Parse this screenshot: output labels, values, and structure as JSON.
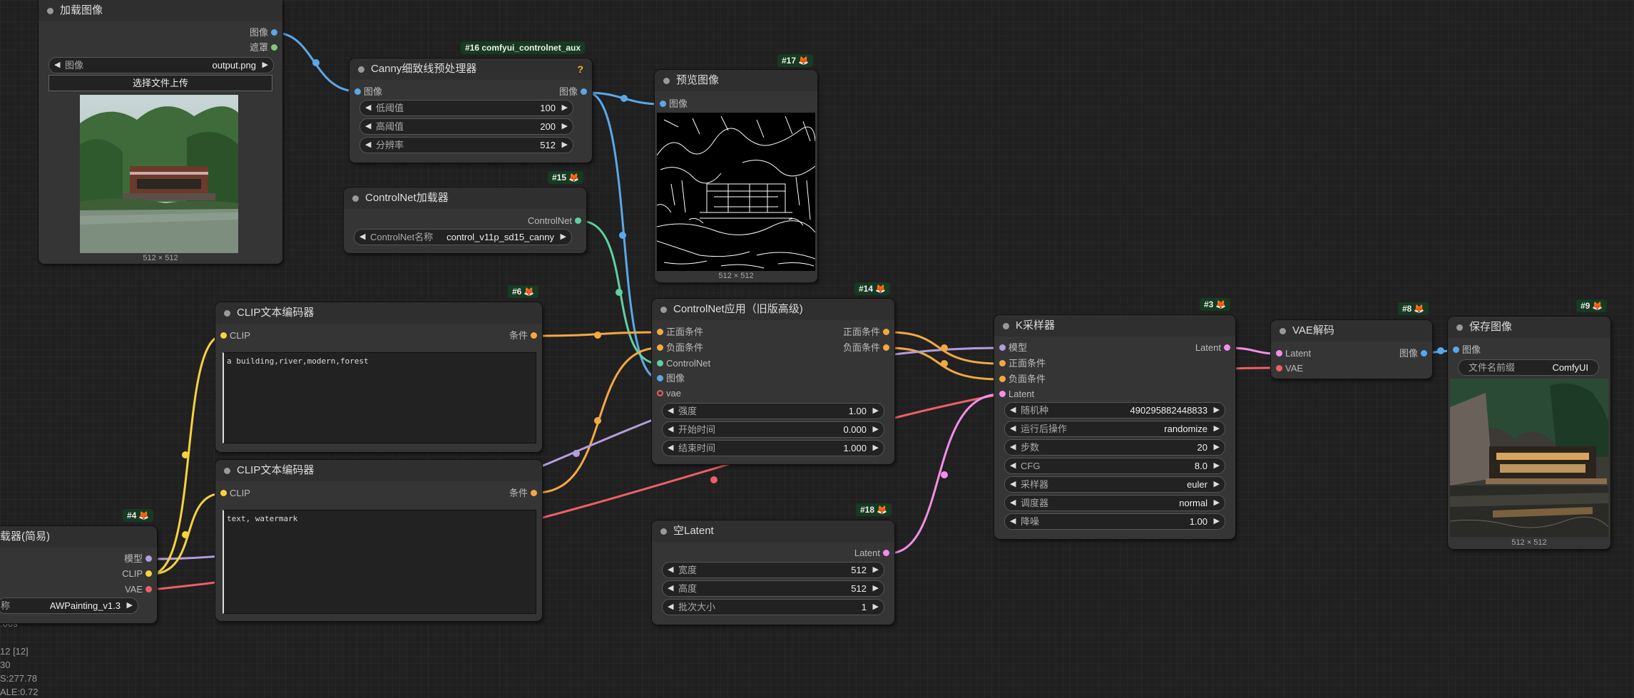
{
  "colors": {
    "image": "#5aa8e8",
    "mask": "#81c77b",
    "controlnet": "#5fd1a2",
    "conditioning": "#f5a842",
    "model": "#b39ddb",
    "clip": "#f6d33c",
    "vae": "#ee5f64",
    "latent": "#f48ee8"
  },
  "nodes": {
    "load_image": {
      "title": "加载图像",
      "out_image": "图像",
      "out_mask": "遮罩",
      "image_label": "图像",
      "image_value": "output.png",
      "upload": "选择文件上传",
      "dims": "512 × 512"
    },
    "canny": {
      "badge": "#16 comfyui_controlnet_aux",
      "title": "Canny细致线预处理器",
      "help": "?",
      "in_image": "图像",
      "out_image": "图像",
      "w1_label": "低阈值",
      "w1_value": "100",
      "w2_label": "高阈值",
      "w2_value": "200",
      "w3_label": "分辨率",
      "w3_value": "512"
    },
    "preview": {
      "badge": "#17",
      "title": "预览图像",
      "in_image": "图像",
      "dims": "512 × 512"
    },
    "cnloader": {
      "badge": "#15",
      "title": "ControlNet加载器",
      "out_cn": "ControlNet",
      "w_label": "ControlNet名称",
      "w_value": "control_v11p_sd15_canny"
    },
    "clip_pos": {
      "badge": "#6",
      "title": "CLIP文本编码器",
      "in_clip": "CLIP",
      "out_cond": "条件",
      "text": "a building,river,modern,forest"
    },
    "clip_neg": {
      "title": "CLIP文本编码器",
      "in_clip": "CLIP",
      "out_cond": "条件",
      "text": "text, watermark"
    },
    "checkpoint": {
      "badge": "#4",
      "title": "载器(简易)",
      "out_model": "模型",
      "out_clip": "CLIP",
      "out_vae": "VAE",
      "w_label": "称",
      "w_value": "AWPainting_v1.3"
    },
    "cnapply": {
      "badge": "#14",
      "title": "ControlNet应用（旧版高级)",
      "in_pos": "正面条件",
      "in_neg": "负面条件",
      "in_cn": "ControlNet",
      "in_image": "图像",
      "in_vae": "vae",
      "out_pos": "正面条件",
      "out_neg": "负面条件",
      "w1_label": "强度",
      "w1_value": "1.00",
      "w2_label": "开始时间",
      "w2_value": "0.000",
      "w3_label": "结束时间",
      "w3_value": "1.000"
    },
    "ksampler": {
      "badge": "#3",
      "title": "K采样器",
      "in_model": "模型",
      "in_pos": "正面条件",
      "in_neg": "负面条件",
      "in_latent": "Latent",
      "out_latent": "Latent",
      "widgets": [
        {
          "label": "随机种",
          "value": "490295882448833"
        },
        {
          "label": "运行后操作",
          "value": "randomize"
        },
        {
          "label": "步数",
          "value": "20"
        },
        {
          "label": "CFG",
          "value": "8.0"
        },
        {
          "label": "采样器",
          "value": "euler"
        },
        {
          "label": "调度器",
          "value": "normal"
        },
        {
          "label": "降噪",
          "value": "1.00"
        }
      ]
    },
    "latent": {
      "badge": "#18",
      "title": "空Latent",
      "out_latent": "Latent",
      "w1_label": "宽度",
      "w1_value": "512",
      "w2_label": "高度",
      "w2_value": "512",
      "w3_label": "批次大小",
      "w3_value": "1"
    },
    "vaedecode": {
      "badge": "#8",
      "title": "VAE解码",
      "in_latent": "Latent",
      "in_vae": "VAE",
      "out_image": "图像"
    },
    "save": {
      "badge": "#9",
      "title": "保存图像",
      "in_image": "图像",
      "w_label": "文件名前缀",
      "w_value": "ComfyUI",
      "dims": "512 × 512"
    }
  },
  "stats": [
    ".00s",
    "12 [12]",
    "30",
    "S:277.78",
    "ALE:0.72"
  ]
}
